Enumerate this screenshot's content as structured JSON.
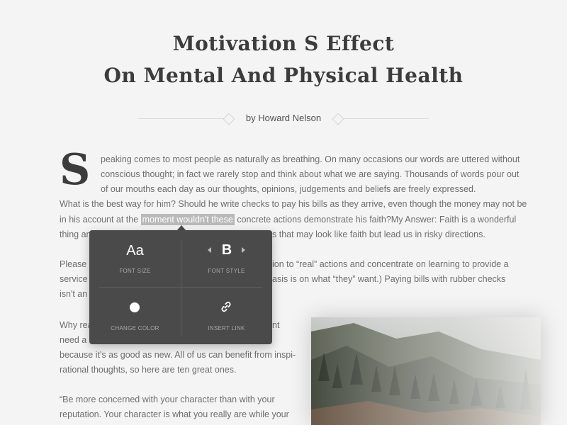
{
  "article": {
    "title_line1": "Motivation S Effect",
    "title_line2": "On Mental And Physical Health",
    "byline": "by Howard Nelson",
    "dropcap": "S",
    "lines": {
      "l1": "peaking comes to most people as naturally as breathing. On many occasions our words are uttered without",
      "l2": "conscious thought; in fact we rarely stop and think about what we are saying. Thousands of words pour out",
      "l3": "of our mouths each day as our thoughts, opinions, judgements and beliefs are freely expressed.",
      "l4": "What is the best way for him? Should he write checks to pay his bills as they arrive, even though the money may not be",
      "l5a": "in his account at the",
      "l5_highlight": "moment wouldn't these",
      "l5b": "concrete actions demonstrate his faith?My Answer: Faith is a wonderful",
      "l6a": "thing an",
      "l6b": "s that may look like faith but lead us in risky directions.",
      "l7a": "Please t",
      "l7b": "ion to “real” actions and concentrate on learning to provide a",
      "l8a": "service",
      "l8b": "asis is on what “they” want.) Paying bills with rubber checks",
      "l9a": "isn't an",
      "l10a": "Why rea",
      "l10b": "nt",
      "l11a": "need a l",
      "l12": "because it's as good as new. All of us can benefit from inspi-",
      "l13": "rational thoughts, so here are ten great ones.",
      "l14": "“Be more concerned with your character than with your",
      "l15": "reputation. Your character is what you really are while your"
    }
  },
  "format_popup": {
    "font_size_glyph": "Aa",
    "font_size_label": "FONT SIZE",
    "font_style_glyph": "B",
    "font_style_label": "FONT STYLE",
    "change_color_label": "CHANGE COLOR",
    "insert_link_label": "INSERT LINK"
  },
  "image": {
    "description_icon": "forest-mountain-photo"
  }
}
